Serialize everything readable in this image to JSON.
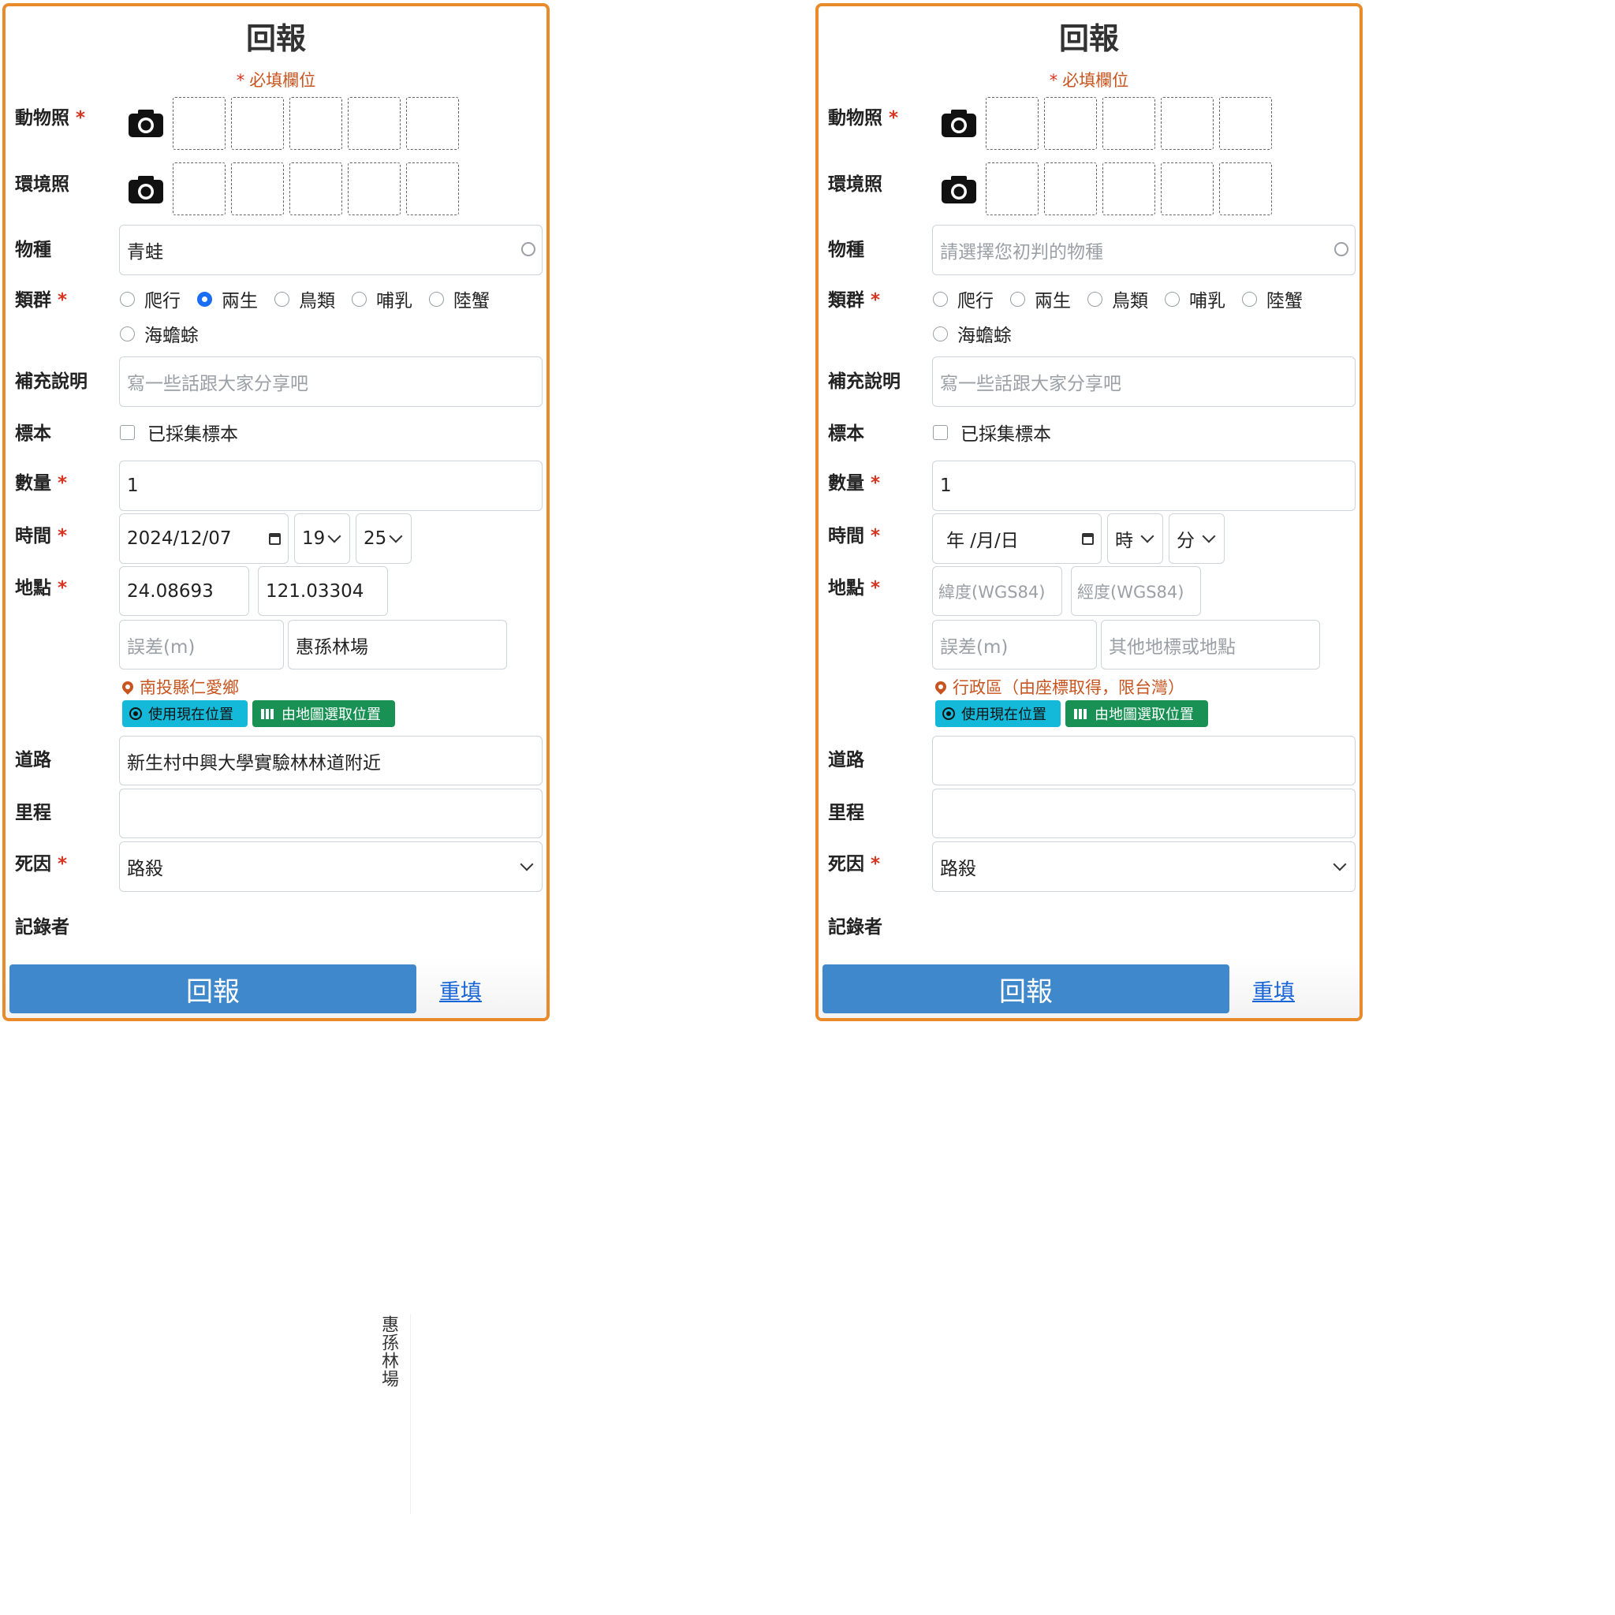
{
  "panels": [
    {
      "title": "回報",
      "required_note": "必填欄位",
      "star": "*",
      "labels": {
        "animal_photo": "動物照",
        "env_photo": "環境照",
        "species": "物種",
        "group": "類群",
        "notes": "補充說明",
        "specimen": "標本",
        "count": "數量",
        "time": "時間",
        "location": "地點",
        "road": "道路",
        "mileage": "里程",
        "cause": "死因",
        "recorder": "記錄者"
      },
      "species": {
        "value": "青蛙",
        "placeholder": "請選擇您初判的物種"
      },
      "group_options": [
        "爬行",
        "兩生",
        "鳥類",
        "哺乳",
        "陸蟹",
        "海蟾蜍"
      ],
      "group_selected": "兩生",
      "notes_placeholder": "寫一些話跟大家分享吧",
      "specimen_label": "已採集標本",
      "count": "1",
      "date": "2024/12/07",
      "hour": "19",
      "minute": "25",
      "lat": "24.08693",
      "lng": "121.03304",
      "error_placeholder": "誤差(m)",
      "landmark": "惠孫林場",
      "admin_area": "南投縣仁愛鄉",
      "btn_current": "使用現在位置",
      "btn_map": "由地圖選取位置",
      "road": "新生村中興大學實驗林林道附近",
      "mileage": "",
      "cause": "路殺",
      "submit": "回報",
      "reset": "重填"
    },
    {
      "title": "回報",
      "required_note": "必填欄位",
      "star": "*",
      "labels": {
        "animal_photo": "動物照",
        "env_photo": "環境照",
        "species": "物種",
        "group": "類群",
        "notes": "補充說明",
        "specimen": "標本",
        "count": "數量",
        "time": "時間",
        "location": "地點",
        "road": "道路",
        "mileage": "里程",
        "cause": "死因",
        "recorder": "記錄者"
      },
      "species": {
        "value": "",
        "placeholder": "請選擇您初判的物種"
      },
      "group_options": [
        "爬行",
        "兩生",
        "鳥類",
        "哺乳",
        "陸蟹",
        "海蟾蜍"
      ],
      "group_selected": "",
      "notes_placeholder": "寫一些話跟大家分享吧",
      "specimen_label": "已採集標本",
      "count": "1",
      "date": "年 /月/日",
      "hour": "時",
      "minute": "分",
      "lat_placeholder": "緯度(WGS84)",
      "lng_placeholder": "經度(WGS84)",
      "error_placeholder": "誤差(m)",
      "landmark_placeholder": "其他地標或地點",
      "admin_area": "行政區（由座標取得，限台灣）",
      "btn_current": "使用現在位置",
      "btn_map": "由地圖選取位置",
      "road": "",
      "mileage": "",
      "cause": "路殺",
      "submit": "回報",
      "reset": "重填"
    }
  ],
  "floating_text": "惠孫林場",
  "colors": {
    "panel_border": "#e98b2a",
    "required": "#d8331f",
    "admin_text": "#c8541f",
    "submit_bg": "#3f88cc",
    "btn_current_bg": "#14b8d8",
    "btn_map_bg": "#199054",
    "radio_selected": "#1a6ef5",
    "link": "#1765d6"
  },
  "icons": [
    "camera-icon",
    "search-circle-icon",
    "calendar-icon",
    "chevron-down-icon",
    "map-pin-icon",
    "target-icon",
    "map-icon"
  ]
}
